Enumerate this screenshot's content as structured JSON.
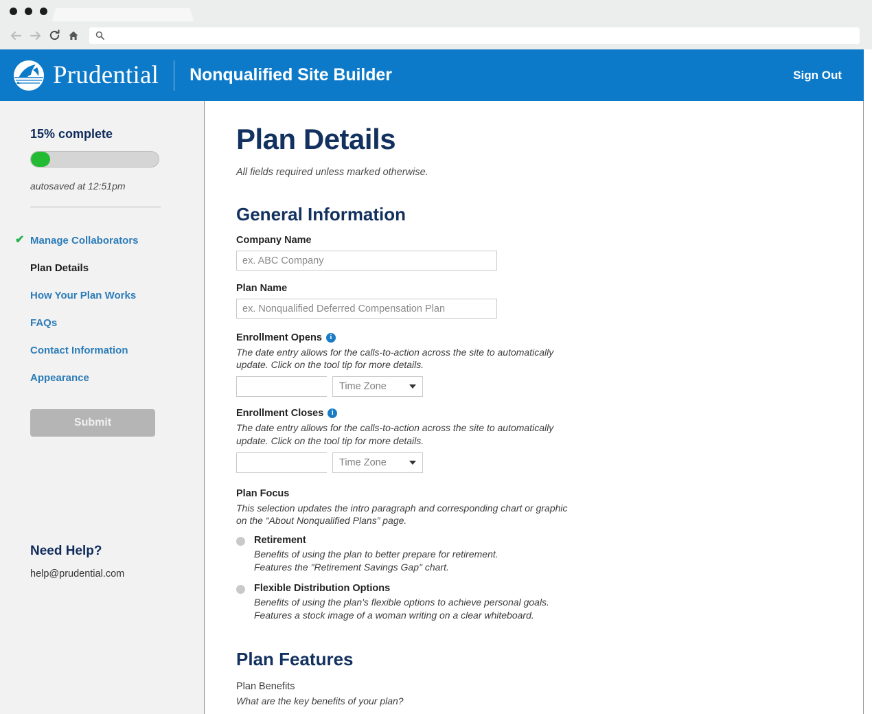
{
  "browser": {
    "back_icon": "back-arrow-icon",
    "forward_icon": "forward-arrow-icon",
    "reload_icon": "reload-icon",
    "home_icon": "home-icon",
    "search_icon": "search-icon",
    "address_value": "",
    "address_placeholder": "",
    "tab_label": ""
  },
  "header": {
    "brand_name": "Prudential",
    "app_title": "Nonqualified Site Builder",
    "sign_out_label": "Sign Out",
    "brand_color": "#0c7ac9"
  },
  "sidebar": {
    "progress_label": "15% complete",
    "progress_percent": 15,
    "progress_color": "#23bb33",
    "autosave_text": "autosaved at 12:51pm",
    "nav_items": [
      {
        "label": "Manage Collaborators",
        "state": "complete",
        "check": "✔"
      },
      {
        "label": "Plan Details",
        "state": "current"
      },
      {
        "label": "How Your Plan Works",
        "state": "link"
      },
      {
        "label": "FAQs",
        "state": "link"
      },
      {
        "label": "Contact Information",
        "state": "link"
      },
      {
        "label": "Appearance",
        "state": "link"
      }
    ],
    "submit_label": "Submit",
    "help_title": "Need Help?",
    "help_email": "help@prudential.com"
  },
  "main": {
    "page_title": "Plan Details",
    "page_subtitle": "All fields required unless marked otherwise.",
    "general_information": {
      "heading": "General Information",
      "company_name": {
        "label": "Company Name",
        "value": "",
        "placeholder": "ex. ABC Company"
      },
      "plan_name": {
        "label": "Plan Name",
        "value": "",
        "placeholder": "ex. Nonqualified Deferred Compensation Plan"
      },
      "enrollment_opens": {
        "label": "Enrollment Opens",
        "help": "The date entry allows for the calls-to-action across the site to automatically update. Click on the tool tip for more details.",
        "date_value": "",
        "date_placeholder": "",
        "timezone_value": "Time Zone"
      },
      "enrollment_closes": {
        "label": "Enrollment Closes",
        "help": "The date entry allows for the calls-to-action across the site to automatically update. Click on the tool tip for more details.",
        "date_value": "",
        "date_placeholder": "",
        "timezone_value": "Time Zone"
      },
      "plan_focus": {
        "label": "Plan Focus",
        "help": "This selection updates the intro paragraph and corresponding chart or graphic on the “About Nonqualified Plans” page.",
        "options": [
          {
            "label": "Retirement",
            "desc_line1": "Benefits of using the plan to better prepare for retirement.",
            "desc_line2": "Features the \"Retirement Savings Gap\" chart.",
            "selected": false
          },
          {
            "label": "Flexible Distribution Options",
            "desc_line1": "Benefits of using the plan's flexible options to achieve personal goals.",
            "desc_line2": "Features a stock image of a woman writing on a clear whiteboard.",
            "selected": false
          }
        ]
      }
    },
    "plan_features": {
      "heading": "Plan Features",
      "plan_benefits_label": "Plan Benefits",
      "plan_benefits_help": "What are the key benefits of your plan?"
    }
  }
}
